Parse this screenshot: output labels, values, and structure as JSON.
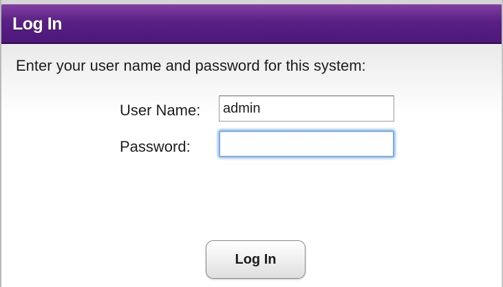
{
  "dialog": {
    "title": "Log In",
    "instruction": "Enter your user name and password for this system:"
  },
  "form": {
    "username": {
      "label": "User Name:",
      "value": "admin"
    },
    "password": {
      "label": "Password:",
      "value": ""
    },
    "submit_label": "Log In"
  },
  "colors": {
    "title_bar": "#5a1f84",
    "title_text": "#ffffff",
    "focus_ring": "#7eadde"
  }
}
